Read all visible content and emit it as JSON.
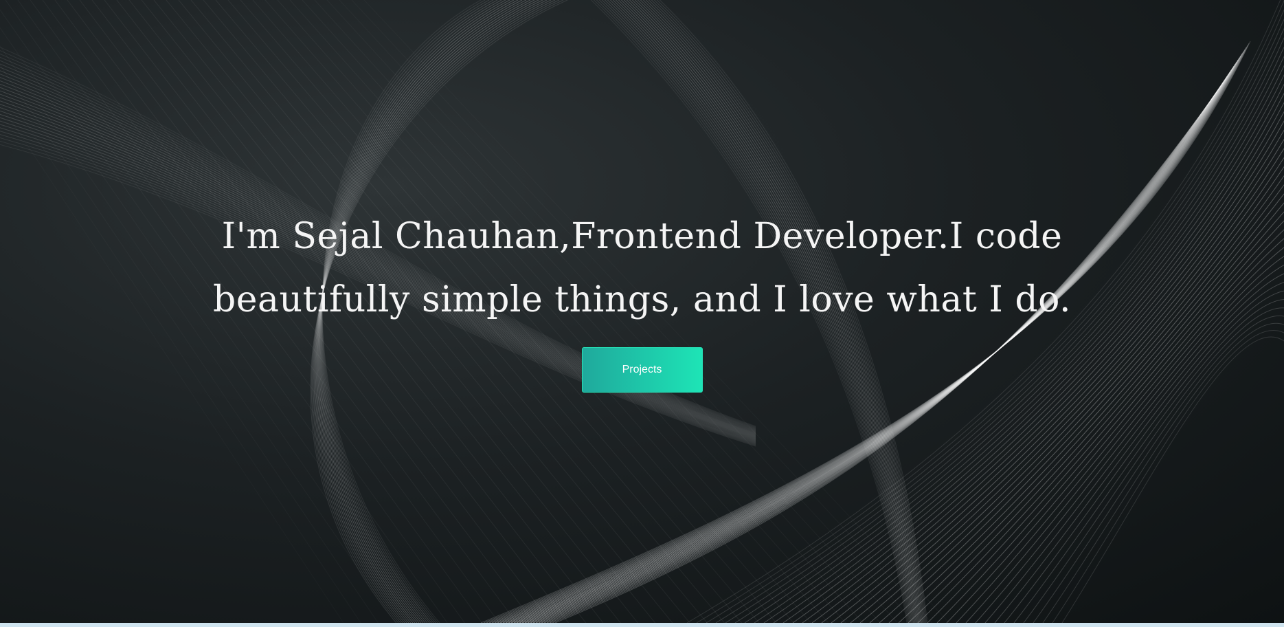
{
  "hero": {
    "heading": "I'm Sejal Chauhan,Frontend Developer.I code beautifully simple things, and I love what I do.",
    "button_label": "Projects"
  },
  "colors": {
    "background_dark": "#161b1d",
    "accent_start": "#1fa99c",
    "accent_end": "#1ee4b6",
    "text": "#f5f5f5"
  }
}
